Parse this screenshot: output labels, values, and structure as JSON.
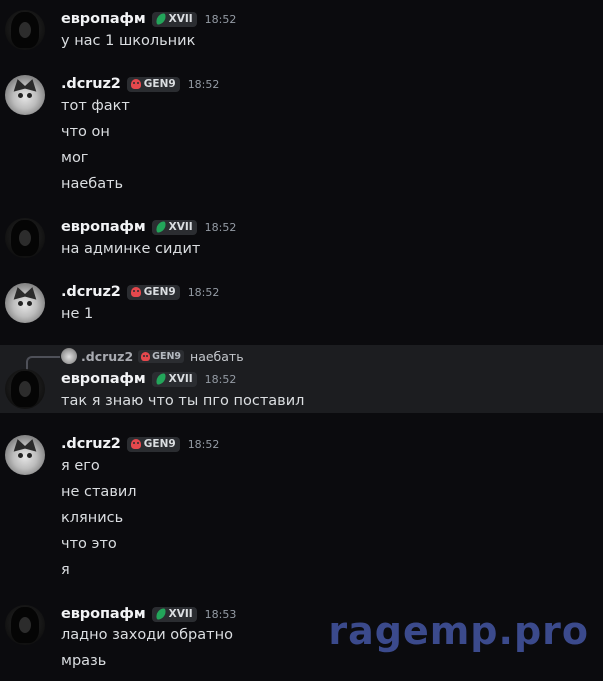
{
  "messages": [
    {
      "author": "европафм",
      "tag": "XVII",
      "tag_icon": "leaf-icon",
      "time": "18:52",
      "lines": [
        "у нас 1 школьник"
      ]
    },
    {
      "author": ".dcruz2",
      "tag": "GEN9",
      "tag_icon": "skull-icon",
      "time": "18:52",
      "lines": [
        "тот факт",
        "что он",
        "мог",
        "наебать"
      ]
    },
    {
      "author": "европафм",
      "tag": "XVII",
      "tag_icon": "leaf-icon",
      "time": "18:52",
      "lines": [
        "на админке сидит"
      ]
    },
    {
      "author": ".dcruz2",
      "tag": "GEN9",
      "tag_icon": "skull-icon",
      "time": "18:52",
      "lines": [
        "не 1"
      ]
    },
    {
      "reply": {
        "author": ".dcruz2",
        "tag": "GEN9",
        "text": "наебать"
      },
      "author": "европафм",
      "tag": "XVII",
      "tag_icon": "leaf-icon",
      "time": "18:52",
      "lines": [
        "так я знаю что ты пго поставил"
      ]
    },
    {
      "author": ".dcruz2",
      "tag": "GEN9",
      "tag_icon": "skull-icon",
      "time": "18:52",
      "lines": [
        "я его",
        "не ставил",
        "клянись",
        "что это",
        "я"
      ]
    },
    {
      "author": "европафм",
      "tag": "XVII",
      "tag_icon": "leaf-icon",
      "time": "18:53",
      "lines": [
        "ладно заходи обратно",
        "мразь"
      ]
    }
  ],
  "watermark": "ragemp.pro",
  "colors": {
    "background": "#0b0b0e",
    "highlight": "#1c1d20",
    "leaf_tag": "#23a55a",
    "skull_tag": "#e5484d",
    "watermark": "#3b4a8c"
  }
}
